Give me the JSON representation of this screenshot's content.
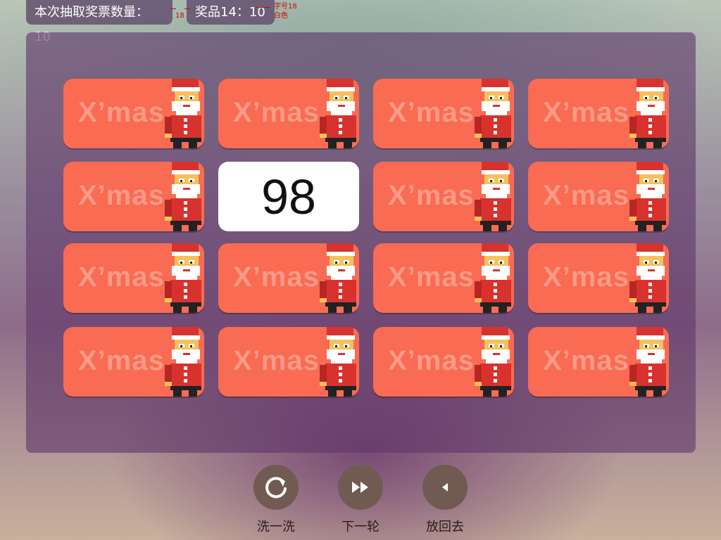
{
  "header": {
    "draw_count_label": "本次抽取奖票数量：10",
    "prize_label": "奖品14：10"
  },
  "annotations": {
    "size_a": "18",
    "size_note_line1": "字号18",
    "size_note_line2": "白色"
  },
  "cards": [
    {
      "state": "back",
      "text": "X’mas"
    },
    {
      "state": "back",
      "text": "X’mas"
    },
    {
      "state": "back",
      "text": "X’mas"
    },
    {
      "state": "back",
      "text": "X’mas"
    },
    {
      "state": "back",
      "text": "X’mas"
    },
    {
      "state": "face",
      "text": "98"
    },
    {
      "state": "back",
      "text": "X’mas"
    },
    {
      "state": "back",
      "text": "X’mas"
    },
    {
      "state": "back",
      "text": "X’mas"
    },
    {
      "state": "back",
      "text": "X’mas"
    },
    {
      "state": "back",
      "text": "X’mas"
    },
    {
      "state": "back",
      "text": "X’mas"
    },
    {
      "state": "back",
      "text": "X’mas"
    },
    {
      "state": "back",
      "text": "X’mas"
    },
    {
      "state": "back",
      "text": "X’mas"
    },
    {
      "state": "back",
      "text": "X’mas"
    }
  ],
  "controls": {
    "shuffle": {
      "label": "洗一洗",
      "icon": "refresh-icon"
    },
    "next": {
      "label": "下一轮",
      "icon": "fast-forward-icon"
    },
    "back": {
      "label": "放回去",
      "icon": "play-back-icon"
    }
  },
  "colors": {
    "card_back": "#f96b52",
    "card_face": "#ffffff",
    "control_button": "#715a52"
  }
}
